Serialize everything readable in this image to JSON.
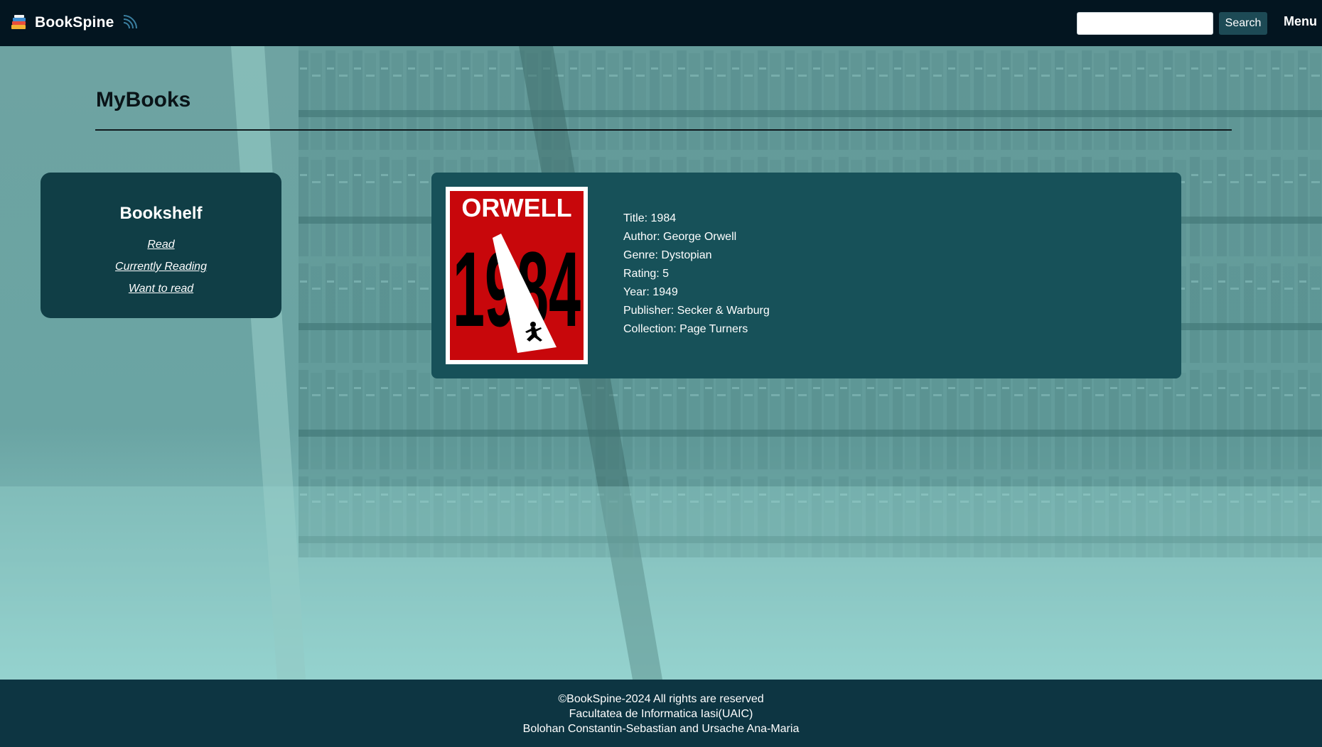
{
  "navbar": {
    "brand": "BookSpine",
    "logo_icon": "books-stack-icon",
    "rss_icon": "rss-feed-icon",
    "search": {
      "value": "",
      "placeholder": ""
    },
    "search_button": "Search",
    "menu": "Menu"
  },
  "page": {
    "title": "MyBooks"
  },
  "sidebar": {
    "title": "Bookshelf",
    "links": [
      "Read",
      "Currently Reading",
      "Want to read"
    ]
  },
  "book": {
    "cover": {
      "top_text": "ORWELL",
      "big_text": "1984",
      "background": "#c8070b"
    },
    "details": [
      "Title: 1984",
      "Author: George Orwell",
      "Genre: Dystopian",
      "Rating: 5",
      "Year: 1949",
      "Publisher: Secker & Warburg",
      "Collection: Page Turners"
    ]
  },
  "footer": {
    "lines": [
      "©BookSpine-2024 All rights are reserved",
      "Facultatea de Informatica Iasi(UAIC)",
      "Bolohan Constantin-Sebastian and Ursache Ana-Maria"
    ]
  },
  "colors": {
    "navbar": "#031520",
    "panel": "#103e46",
    "card": "#175159",
    "footer": "#0d3542",
    "search_button": "#1d4a55"
  }
}
